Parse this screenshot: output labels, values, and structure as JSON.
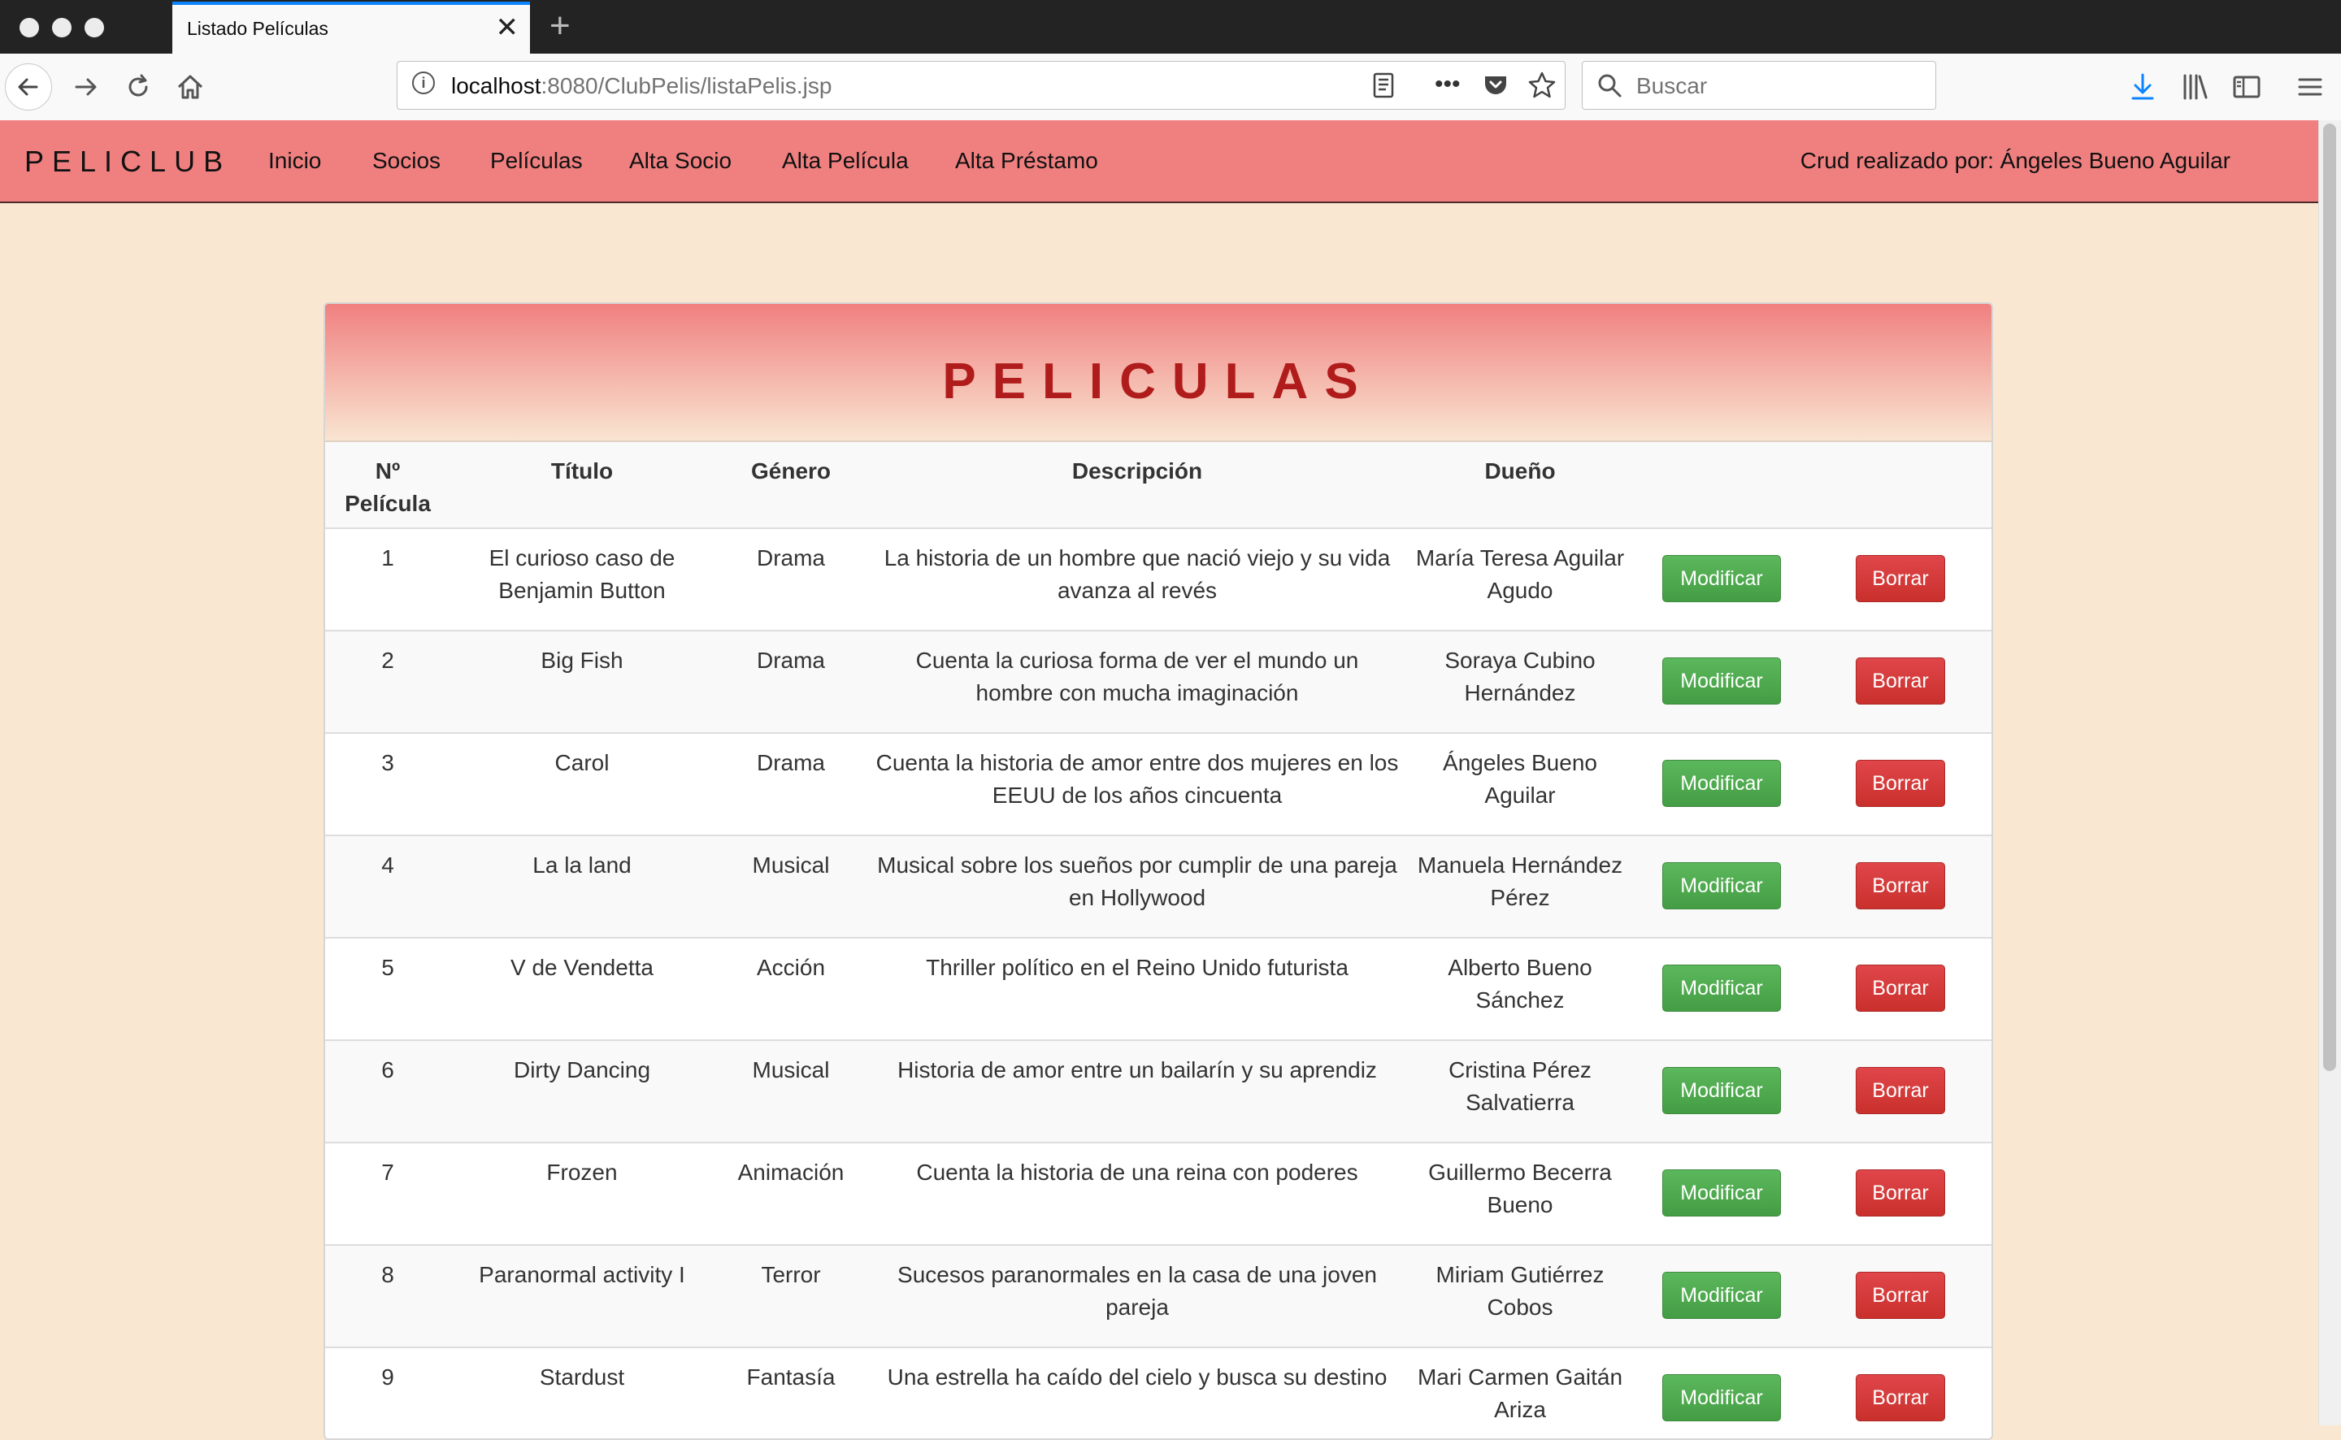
{
  "browser": {
    "tab_title": "Listado Películas",
    "url_host": "localhost",
    "url_path": ":8080/ClubPelis/listaPelis.jsp",
    "search_placeholder": "Buscar",
    "icons": [
      "back-icon",
      "forward-icon",
      "reload-icon",
      "home-icon",
      "info-icon",
      "reader-view-icon",
      "more-icon",
      "pocket-icon",
      "bookmark-star-icon",
      "search-icon",
      "download-icon",
      "library-icon",
      "sidebar-icon",
      "menu-icon",
      "close-icon",
      "new-tab-icon"
    ]
  },
  "site": {
    "brand": "PELICLUB",
    "nav": [
      "Inicio",
      "Socios",
      "Películas",
      "Alta Socio",
      "Alta Película",
      "Alta Préstamo"
    ],
    "credit": "Crud realizado por: Ángeles Bueno Aguilar"
  },
  "panel": {
    "title": "PELICULAS",
    "headers": [
      "Nº Película",
      "Título",
      "Género",
      "Descripción",
      "Dueño"
    ],
    "buttons": {
      "modify": "Modificar",
      "delete": "Borrar"
    },
    "rows": [
      {
        "num": "1",
        "titulo": "El curioso caso de Benjamin Button",
        "genero": "Drama",
        "descripcion": "La historia de un hombre que nació viejo y su vida avanza al revés",
        "dueno": "María Teresa Aguilar Agudo"
      },
      {
        "num": "2",
        "titulo": "Big Fish",
        "genero": "Drama",
        "descripcion": "Cuenta la curiosa forma de ver el mundo un hombre con mucha imaginación",
        "dueno": "Soraya Cubino Hernández"
      },
      {
        "num": "3",
        "titulo": "Carol",
        "genero": "Drama",
        "descripcion": "Cuenta la historia de amor entre dos mujeres en los EEUU de los años cincuenta",
        "dueno": "Ángeles Bueno Aguilar"
      },
      {
        "num": "4",
        "titulo": "La la land",
        "genero": "Musical",
        "descripcion": "Musical sobre los sueños por cumplir de una pareja en Hollywood",
        "dueno": "Manuela Hernández Pérez"
      },
      {
        "num": "5",
        "titulo": "V de Vendetta",
        "genero": "Acción",
        "descripcion": "Thriller político en el Reino Unido futurista",
        "dueno": "Alberto Bueno Sánchez"
      },
      {
        "num": "6",
        "titulo": "Dirty Dancing",
        "genero": "Musical",
        "descripcion": "Historia de amor entre un bailarín y su aprendiz",
        "dueno": "Cristina Pérez Salvatierra"
      },
      {
        "num": "7",
        "titulo": "Frozen",
        "genero": "Animación",
        "descripcion": "Cuenta la historia de una reina con poderes",
        "dueno": "Guillermo Becerra Bueno"
      },
      {
        "num": "8",
        "titulo": "Paranormal activity I",
        "genero": "Terror",
        "descripcion": "Sucesos paranormales en la casa de una joven pareja",
        "dueno": "Miriam Gutiérrez Cobos"
      },
      {
        "num": "9",
        "titulo": "Stardust",
        "genero": "Fantasía",
        "descripcion": "Una estrella ha caído del cielo y busca su destino",
        "dueno": "Mari Carmen Gaitán Ariza"
      }
    ]
  },
  "colors": {
    "page_bg": "#f9e7d2",
    "navbar_bg": "#f08080",
    "title_color": "#b01c1c",
    "modify_btn": "#5cb85c",
    "delete_btn": "#d9534f"
  }
}
